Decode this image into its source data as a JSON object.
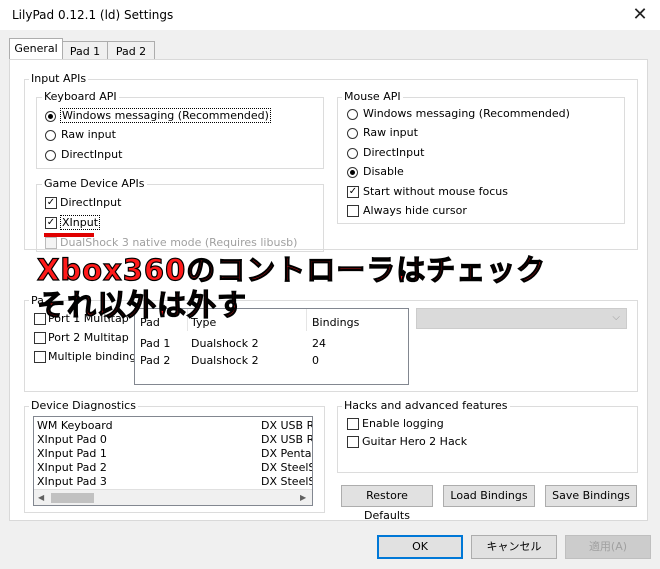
{
  "window": {
    "title": "LilyPad 0.12.1 (ld) Settings"
  },
  "tabs": [
    "General",
    "Pad 1",
    "Pad 2"
  ],
  "input_apis": {
    "label": "Input APIs",
    "keyboard_api": {
      "label": "Keyboard API",
      "options": [
        "Windows messaging (Recommended)",
        "Raw input",
        "DirectInput"
      ],
      "selected": "Windows messaging (Recommended)"
    },
    "mouse_api": {
      "label": "Mouse API",
      "options": [
        "Windows messaging (Recommended)",
        "Raw input",
        "DirectInput",
        "Disable"
      ],
      "selected": "Disable",
      "checks": [
        {
          "label": "Start without mouse focus",
          "checked": true
        },
        {
          "label": "Always hide cursor",
          "checked": false
        }
      ]
    },
    "game_device_apis": {
      "label": "Game Device APIs",
      "items": [
        {
          "label": "DirectInput",
          "checked": true
        },
        {
          "label": "XInput",
          "checked": true
        },
        {
          "label": "DualShock 3 native mode (Requires libusb)",
          "checked": false
        }
      ]
    }
  },
  "annotation": {
    "line1": "Xbox360のコントローラはチェック",
    "line2": "それ以外は外す"
  },
  "pads": {
    "label_fragment": "Pa",
    "checks": [
      "Port 1 Multitap",
      "Port 2 Multitap",
      "Multiple bindings"
    ],
    "table_headers": [
      "Pad",
      "Type",
      "Bindings"
    ],
    "rows": [
      {
        "pad": "Pad 1",
        "type": "Dualshock 2",
        "bindings": "24"
      },
      {
        "pad": "Pad 2",
        "type": "Dualshock 2",
        "bindings": "0"
      }
    ]
  },
  "device_diagnostics": {
    "label": "Device Diagnostics",
    "rows": [
      {
        "name": "WM Keyboard",
        "api": "DX USB Re"
      },
      {
        "name": "XInput Pad 0",
        "api": "DX USB Re"
      },
      {
        "name": "XInput Pad 1",
        "api": "DX Pentab"
      },
      {
        "name": "XInput Pad 2",
        "api": "DX SteelSe"
      },
      {
        "name": "XInput Pad 3",
        "api": "DX SteelSe"
      }
    ]
  },
  "hacks": {
    "label": "Hacks and advanced features",
    "checks": [
      {
        "label": "Enable logging",
        "checked": false
      },
      {
        "label": "Guitar Hero 2 Hack",
        "checked": false
      }
    ]
  },
  "buttons": {
    "restore": "Restore Defaults",
    "load": "Load Bindings",
    "save": "Save Bindings",
    "ok": "OK",
    "cancel": "キャンセル",
    "apply": "適用(A)"
  }
}
